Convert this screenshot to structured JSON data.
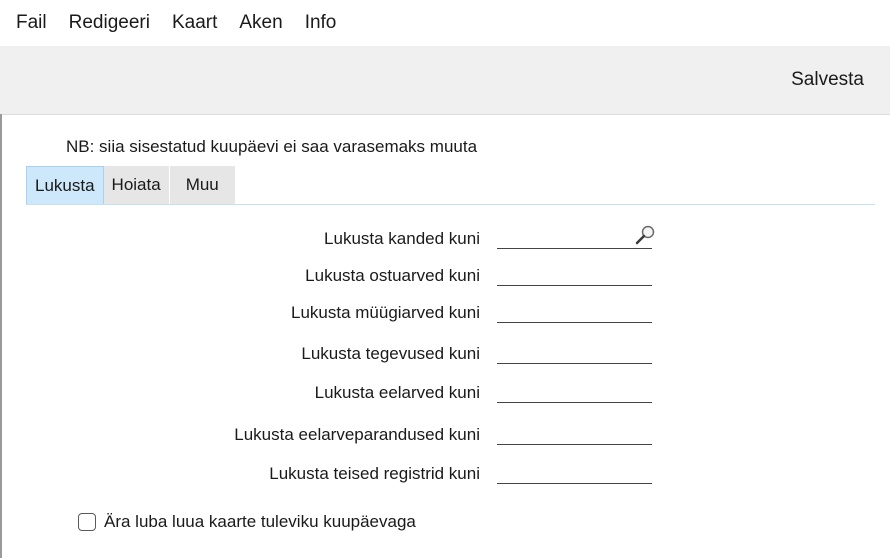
{
  "menubar": {
    "items": [
      "Fail",
      "Redigeeri",
      "Kaart",
      "Aken",
      "Info"
    ]
  },
  "toolbar": {
    "save_label": "Salvesta"
  },
  "form": {
    "note": "NB: siia sisestatud kuupäevi ei saa varasemaks muuta",
    "tabs": [
      "Lukusta",
      "Hoiata",
      "Muu"
    ],
    "active_tab": "Lukusta",
    "rows": [
      {
        "label": "Lukusta kanded kuni",
        "value": ""
      },
      {
        "label": "Lukusta ostuarved kuni",
        "value": ""
      },
      {
        "label": "Lukusta müügiarved kuni",
        "value": ""
      },
      {
        "label": "Lukusta tegevused kuni",
        "value": ""
      },
      {
        "label": "Lukusta eelarved kuni",
        "value": ""
      },
      {
        "label": "Lukusta eelarveparandused kuni",
        "value": ""
      },
      {
        "label": "Lukusta teised registrid kuni",
        "value": ""
      }
    ],
    "checkbox": {
      "label": "Ära luba luua kaarte tuleviku kuupäevaga",
      "checked": false
    }
  },
  "icons": {
    "field_lookup": "search-icon"
  },
  "colors": {
    "toolbar_bg": "#f0f0f0",
    "active_tab_bg": "#cde8fb",
    "inactive_tab_bg": "#e6e6e6"
  }
}
